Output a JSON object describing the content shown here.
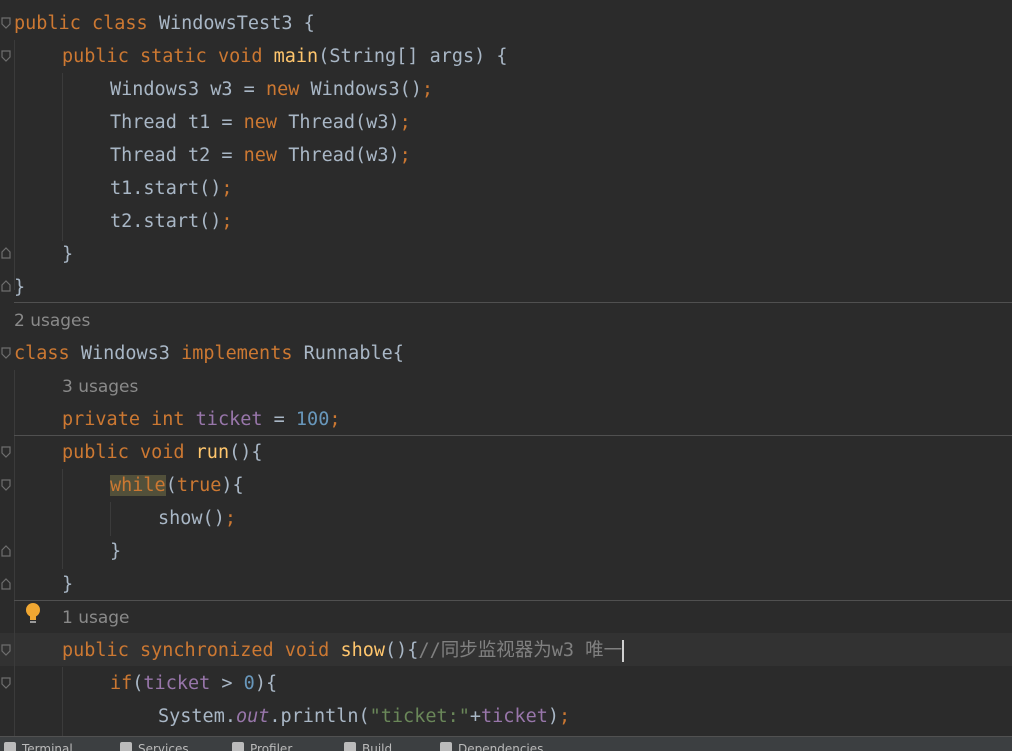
{
  "code": {
    "l1": {
      "kw1": "public",
      "kw2": "class",
      "name": "WindowsTest3 {"
    },
    "l2": {
      "kw1": "public",
      "kw2": "static",
      "kw3": "void",
      "fn": "main",
      "rest": "(String[] args) {"
    },
    "l3": {
      "a": "Windows3 w3 = ",
      "kw": "new",
      "b": "Windows3()",
      "semi": ";"
    },
    "l4": {
      "a": "Thread t1 = ",
      "kw": "new",
      "b": "Thread(w3)",
      "semi": ";"
    },
    "l5": {
      "a": "Thread t2 = ",
      "kw": "new",
      "b": "Thread(w3)",
      "semi": ";"
    },
    "l6": {
      "a": "t1.start()",
      "semi": ";"
    },
    "l7": {
      "a": "t2.start()",
      "semi": ";"
    },
    "l8": {
      "a": "}"
    },
    "l9": {
      "a": "}"
    },
    "usage1": "2 usages",
    "l10": {
      "kw1": "class",
      "a": "Windows3 ",
      "kw2": "implements",
      "b": "Runnable{"
    },
    "usage2": "3 usages",
    "l11": {
      "kw1": "private",
      "kw2": "int",
      "fld": "ticket",
      "eq": " = ",
      "num": "100",
      "semi": ";"
    },
    "l12": {
      "kw1": "public",
      "kw2": "void",
      "fn": "run",
      "rest": "(){"
    },
    "l13": {
      "kw1": "while",
      "p1": "(",
      "kw2": "true",
      "p2": "){"
    },
    "l14": {
      "a": "show()",
      "semi": ";"
    },
    "l15": {
      "a": "}"
    },
    "l16": {
      "a": "}"
    },
    "usage3": "1 usage",
    "l17": {
      "kw1": "public",
      "kw2": "synchronized",
      "kw3": "void",
      "fn": "show",
      "rest": "(){",
      "cmt": "//同步监视器为w3 唯一"
    },
    "l18": {
      "kw": "if",
      "p1": "(",
      "fld": "ticket",
      "rest": " > ",
      "num": "0",
      "p2": "){"
    },
    "l19": {
      "a": "System.",
      "out": "out",
      "b": ".println(",
      "str": "\"ticket:\"",
      "c": "+",
      "fld": "ticket",
      "d": ")",
      "semi": ";"
    }
  },
  "statusbar": {
    "items": [
      "Terminal",
      "Services",
      "Profiler",
      "Build",
      "Dependencies"
    ]
  },
  "colors": {
    "background": "#2b2b2b",
    "keyword": "#cc7832",
    "function": "#ffc66d",
    "field": "#9876aa",
    "number": "#6897bb",
    "string": "#6a8759",
    "comment": "#808080",
    "text": "#a9b7c6"
  },
  "icons": {
    "fold": "fold-marker-icon",
    "bulb": "lightbulb-icon"
  }
}
